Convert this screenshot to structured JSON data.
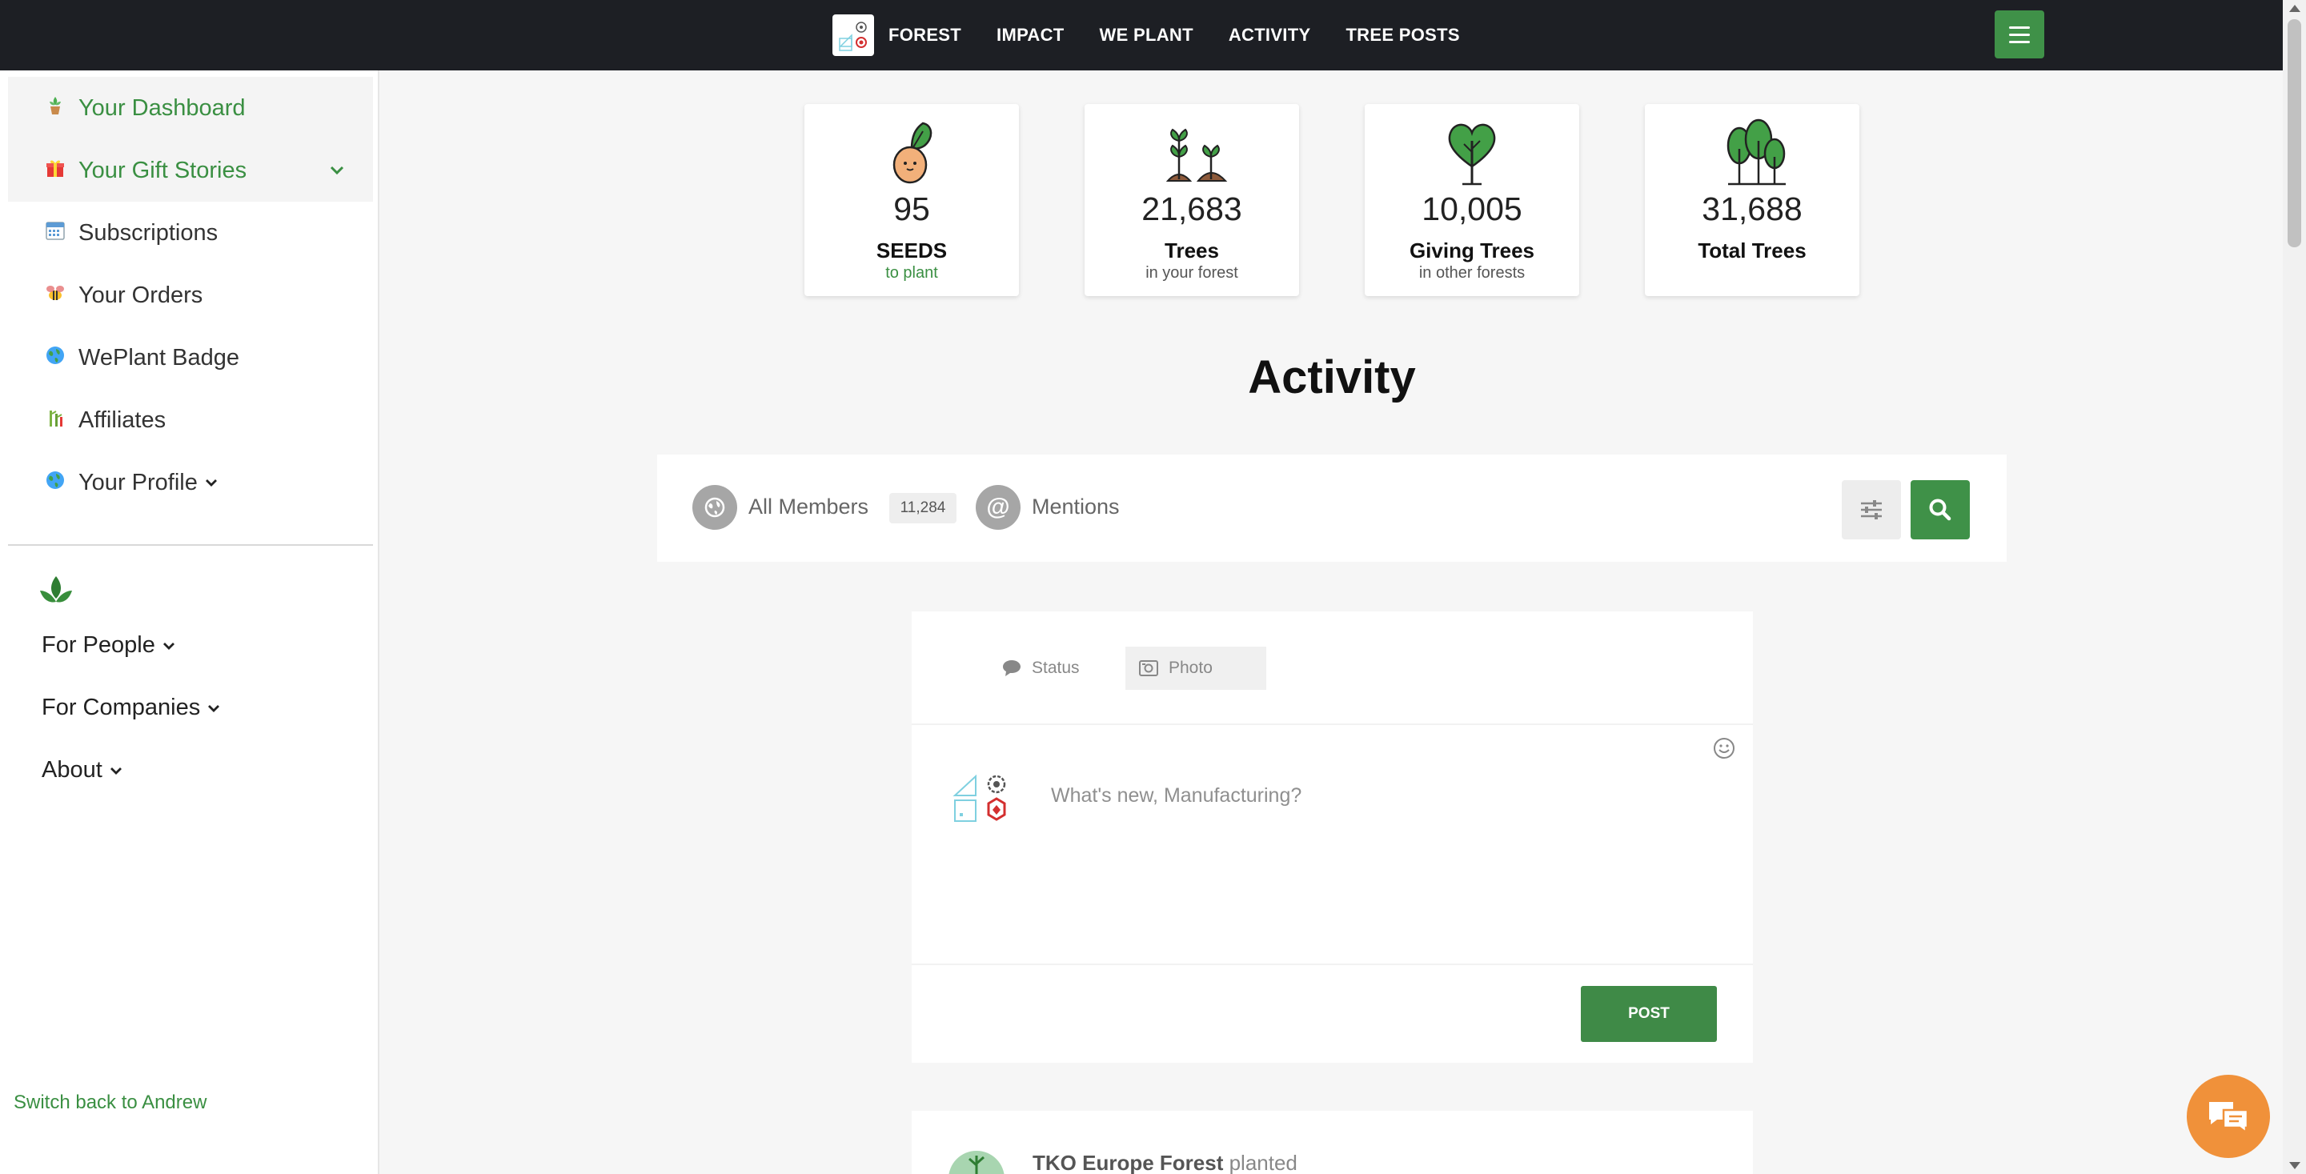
{
  "nav": {
    "items": [
      "FOREST",
      "IMPACT",
      "WE PLANT",
      "ACTIVITY",
      "TREE POSTS"
    ]
  },
  "sidebar": {
    "items": [
      {
        "label": "Your Dashboard",
        "icon": "plant-pot-icon"
      },
      {
        "label": "Your Gift Stories",
        "icon": "gift-icon"
      },
      {
        "label": "Subscriptions",
        "icon": "calendar-icon"
      },
      {
        "label": "Your Orders",
        "icon": "bee-icon"
      },
      {
        "label": "WePlant Badge",
        "icon": "globe-icon"
      },
      {
        "label": "Affiliates",
        "icon": "bamboo-icon"
      },
      {
        "label": "Your Profile",
        "icon": "globe-icon"
      }
    ],
    "links": [
      "For People",
      "For Companies",
      "About"
    ],
    "switch_back": "Switch back to Andrew"
  },
  "stats": [
    {
      "number": "95",
      "label": "SEEDS",
      "sub": "to plant"
    },
    {
      "number": "21,683",
      "label": "Trees",
      "sub": "in your forest"
    },
    {
      "number": "10,005",
      "label": "Giving Trees",
      "sub": "in other forests"
    },
    {
      "number": "31,688",
      "label": "Total Trees",
      "sub": ""
    }
  ],
  "activity": {
    "title": "Activity",
    "filters": {
      "all_members": "All Members",
      "all_members_count": "11,284",
      "mentions": "Mentions"
    }
  },
  "composer": {
    "tab_status": "Status",
    "tab_photo": "Photo",
    "placeholder": "What's new, Manufacturing?",
    "post_label": "POST"
  },
  "feed": {
    "item_name": "TKO Europe Forest",
    "item_action": "planted"
  },
  "colors": {
    "brand_green": "#3f9148",
    "topbar": "#1d1f24",
    "chat_orange": "#f0913a"
  }
}
